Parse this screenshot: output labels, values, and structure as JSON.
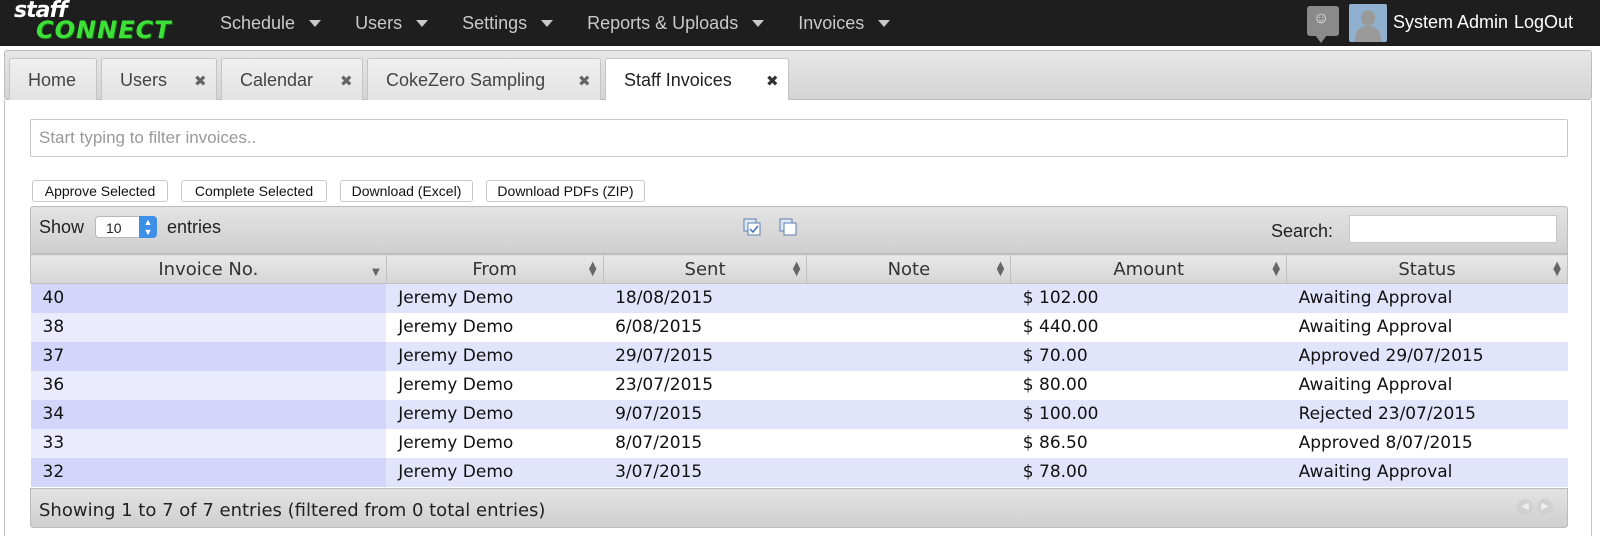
{
  "brand": {
    "line1": "staff",
    "line2": "CONNECT",
    "accent": "#3ee03a"
  },
  "nav": [
    "Schedule",
    "Users",
    "Settings",
    "Reports & Uploads",
    "Invoices"
  ],
  "user": {
    "name": "System Admin",
    "separator": "·",
    "logout": "LogOut"
  },
  "tabs": [
    {
      "label": "Home",
      "closable": false,
      "active": false
    },
    {
      "label": "Users",
      "closable": true,
      "active": false
    },
    {
      "label": "Calendar",
      "closable": true,
      "active": false
    },
    {
      "label": "CokeZero Sampling",
      "closable": true,
      "active": false
    },
    {
      "label": "Staff Invoices",
      "closable": true,
      "active": true
    }
  ],
  "filter": {
    "placeholder": "Start typing to filter invoices..",
    "value": ""
  },
  "actions": [
    "Approve Selected",
    "Complete Selected",
    "Download (Excel)",
    "Download PDFs (ZIP)"
  ],
  "table": {
    "show_label": "Show",
    "page_size": "10",
    "entries_label": "entries",
    "search_label": "Search:",
    "search_value": "",
    "columns": [
      "Invoice No.",
      "From",
      "Sent",
      "Note",
      "Amount",
      "Status"
    ],
    "rows": [
      [
        "40",
        "Jeremy Demo",
        "18/08/2015",
        "",
        "$ 102.00",
        "Awaiting Approval"
      ],
      [
        "38",
        "Jeremy Demo",
        "6/08/2015",
        "",
        "$ 440.00",
        "Awaiting Approval"
      ],
      [
        "37",
        "Jeremy Demo",
        "29/07/2015",
        "",
        "$ 70.00",
        "Approved 29/07/2015"
      ],
      [
        "36",
        "Jeremy Demo",
        "23/07/2015",
        "",
        "$ 80.00",
        "Awaiting Approval"
      ],
      [
        "34",
        "Jeremy Demo",
        "9/07/2015",
        "",
        "$ 100.00",
        "Rejected 23/07/2015"
      ],
      [
        "33",
        "Jeremy Demo",
        "8/07/2015",
        "",
        "$ 86.50",
        "Approved 8/07/2015"
      ],
      [
        "32",
        "Jeremy Demo",
        "3/07/2015",
        "",
        "$ 78.00",
        "Awaiting Approval"
      ]
    ],
    "info": "Showing 1 to 7 of 7 entries (filtered from 0 total entries)"
  },
  "colors": {
    "topbar": "#1e1e1e",
    "row_odd": "#e2e4fb",
    "row_even": "#ffffff",
    "select_accent": "#3d8fe8"
  }
}
